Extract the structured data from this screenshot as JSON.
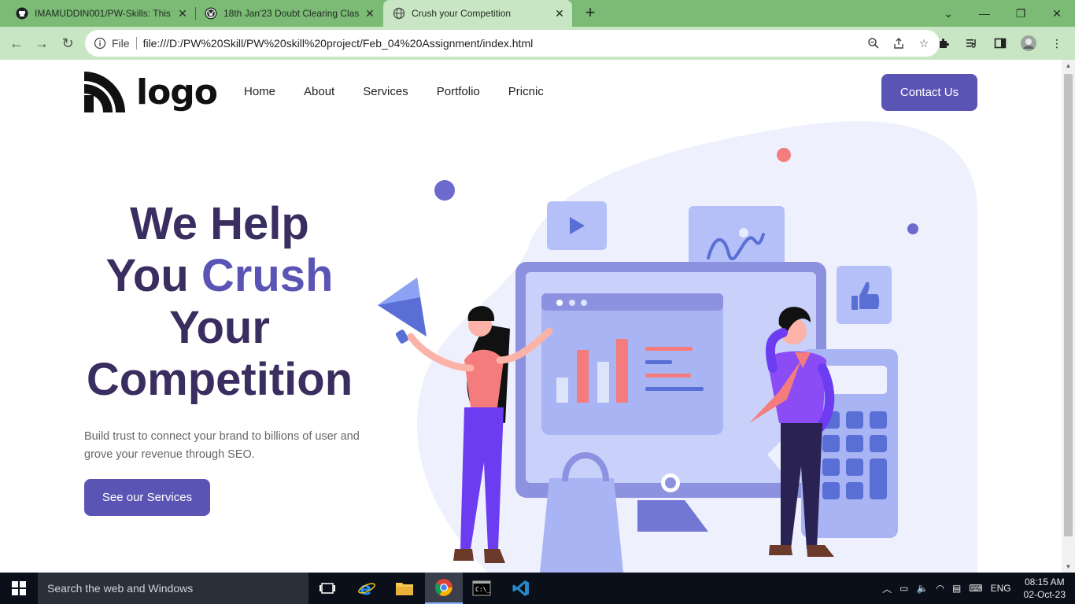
{
  "browser": {
    "tabs": [
      {
        "title": "IMAMUDDIN001/PW-Skills: This",
        "icon": "github-icon"
      },
      {
        "title": "18th Jan'23 Doubt Clearing Clas",
        "icon": "wordpress-icon"
      },
      {
        "title": "Crush your Competition",
        "icon": "globe-icon",
        "active": true
      }
    ],
    "omnibox": {
      "scheme_label": "File",
      "url": "file:///D:/PW%20Skill/PW%20skill%20project/Feb_04%20Assignment/index.html"
    }
  },
  "page": {
    "logo_text": "logo",
    "nav": [
      "Home",
      "About",
      "Services",
      "Portfolio",
      "Pricnic"
    ],
    "contact_label": "Contact Us",
    "hero": {
      "line1": "We Help",
      "line2_a": "You ",
      "line2_b": "Crush",
      "line3": "Your",
      "line4": "Competition",
      "subtitle": "Build trust to connect your brand to billions of user and grove your revenue through SEO.",
      "cta_label": "See our Services"
    },
    "colors": {
      "primary": "#5a55b5",
      "heading": "#3a2d5f",
      "accent_coral": "#f47c7c"
    }
  },
  "taskbar": {
    "search_placeholder": "Search the web and Windows",
    "lang": "ENG",
    "time": "08:15 AM",
    "date": "02-Oct-23"
  }
}
